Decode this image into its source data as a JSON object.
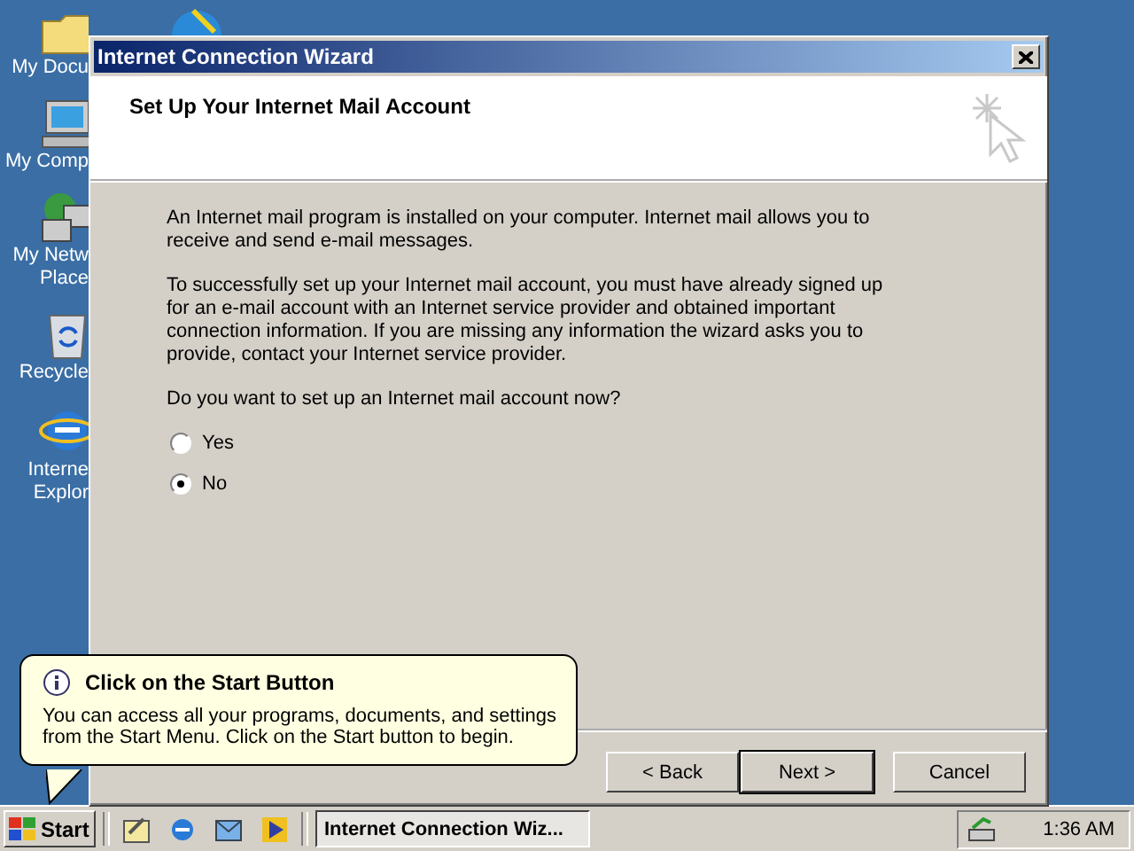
{
  "desktop": {
    "icons": [
      {
        "kind": "folder",
        "label": "My Docu"
      },
      {
        "kind": "computer",
        "label": "My Comp"
      },
      {
        "kind": "network",
        "label": "My Netw Place"
      },
      {
        "kind": "recycle",
        "label": "Recycle"
      },
      {
        "kind": "browser",
        "label": "Interne Explor"
      }
    ]
  },
  "window": {
    "title": "Internet Connection Wizard",
    "header": {
      "title": "Set Up Your Internet Mail Account"
    },
    "paragraphs": [
      "An Internet mail program is installed on your computer. Internet mail allows you to receive and send e-mail messages.",
      "To successfully set up your Internet mail account, you must have already signed up for an e-mail account with an Internet service provider and obtained important connection information. If you are missing any information the wizard asks you to provide, contact your Internet service provider."
    ],
    "question": "Do you want to set up an Internet mail account now?",
    "options": [
      {
        "label": "Yes",
        "selected": false
      },
      {
        "label": "No",
        "selected": true
      }
    ],
    "buttons": [
      {
        "label": "< Back",
        "default": false
      },
      {
        "label": "Next >",
        "default": true
      },
      {
        "label": "Cancel",
        "default": false
      }
    ]
  },
  "balloon": {
    "title": "Click on the Start Button",
    "text": "You can access all your programs, documents, and settings from the Start Menu. Click on the Start button to begin."
  },
  "taskbar": {
    "start": "Start",
    "tasks": [
      {
        "label": "Internet Connection Wiz...",
        "selected": true
      }
    ],
    "clock": "1:36 AM"
  }
}
